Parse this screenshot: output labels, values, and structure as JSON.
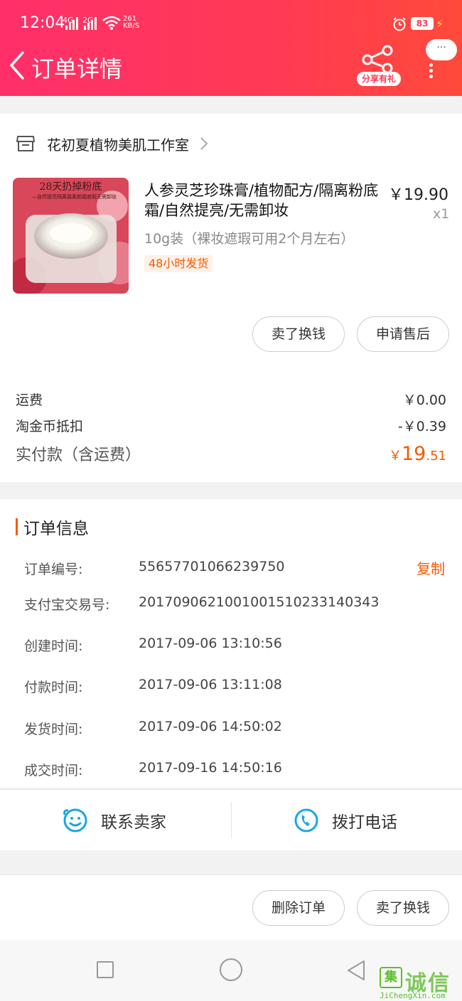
{
  "status_bar": {
    "time": "12:04",
    "net1": "4G",
    "net2": "2G",
    "speed_value": "261",
    "speed_unit": "KB/S",
    "battery": "83"
  },
  "nav": {
    "title": "订单详情",
    "share_label": "分享有礼",
    "more_bubble": "···"
  },
  "shop": {
    "name": "花初夏植物美肌工作室"
  },
  "product": {
    "title": "人参灵芝珍珠膏/植物配方/隔离粉底霜/自然提亮/无需卸妆",
    "spec": "10g装（裸妆遮瑕可用2个月左右）",
    "badge": "48小时发货",
    "price": "￥19.90",
    "qty": "x1",
    "image_caption": "28天扔掉粉底",
    "image_subcaption": "—自然提亮隔离霜素颜霜遮瑕无需卸妆"
  },
  "product_actions": {
    "sell_label": "卖了换钱",
    "after_sale_label": "申请售后"
  },
  "fees": {
    "shipping_label": "运费",
    "shipping_value": "￥0.00",
    "coin_label": "淘金币抵扣",
    "coin_value": "-￥0.39",
    "paid_label": "实付款（含运费）",
    "paid_yen": "￥",
    "paid_int": "19",
    "paid_dec": ".51"
  },
  "order_info": {
    "section_title": "订单信息",
    "copy_label": "复制",
    "rows": [
      {
        "label": "订单编号:",
        "value": "55657701066239750"
      },
      {
        "label": "支付宝交易号:",
        "value": "2017090621001001510233140343"
      },
      {
        "label": "创建时间:",
        "value": "2017-09-06 13:10:56"
      },
      {
        "label": "付款时间:",
        "value": "2017-09-06 13:11:08"
      },
      {
        "label": "发货时间:",
        "value": "2017-09-06 14:50:02"
      },
      {
        "label": "成交时间:",
        "value": "2017-09-16 14:50:16"
      }
    ]
  },
  "contact": {
    "seller_label": "联系卖家",
    "call_label": "拨打电话"
  },
  "bottom_actions": {
    "delete_label": "删除订单",
    "sell_label": "卖了换钱"
  },
  "watermark": {
    "box": "集",
    "text": "诚信",
    "url": "JiChengXin.com"
  },
  "colors": {
    "header_start": "#ff2f6a",
    "header_end": "#ff4a3a",
    "accent_orange": "#f35a00",
    "contact_icon_blue": "#1aa6e6"
  }
}
